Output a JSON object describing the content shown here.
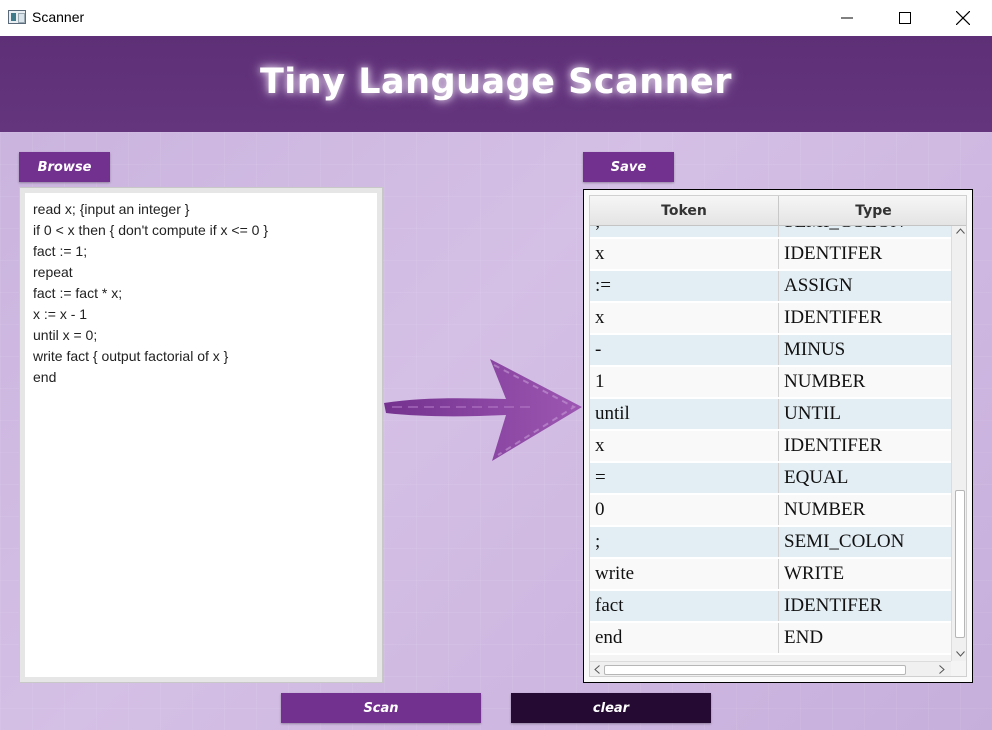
{
  "window": {
    "title": "Scanner",
    "controls": {
      "minimize": "minimize-icon",
      "maximize": "maximize-icon",
      "close": "close-icon"
    }
  },
  "header": {
    "title": "Tiny Language Scanner"
  },
  "buttons": {
    "browse": "Browse",
    "save": "Save",
    "scan": "Scan",
    "clear": "clear"
  },
  "editor": {
    "content": "read x; {input an integer }\nif 0 < x then { don't compute if x <= 0 }\nfact := 1;\nrepeat\nfact := fact * x;\nx := x - 1\nuntil x = 0;\nwrite fact { output factorial of x }\nend"
  },
  "table": {
    "columns": [
      "Token",
      "Type"
    ],
    "rows": [
      {
        "token": ";",
        "type": "SEMI_COLON"
      },
      {
        "token": "x",
        "type": "IDENTIFER"
      },
      {
        "token": ":=",
        "type": "ASSIGN"
      },
      {
        "token": "x",
        "type": "IDENTIFER"
      },
      {
        "token": "-",
        "type": "MINUS"
      },
      {
        "token": "1",
        "type": "NUMBER"
      },
      {
        "token": "until",
        "type": "UNTIL"
      },
      {
        "token": "x",
        "type": "IDENTIFER"
      },
      {
        "token": "=",
        "type": "EQUAL"
      },
      {
        "token": "0",
        "type": "NUMBER"
      },
      {
        "token": ";",
        "type": "SEMI_COLON"
      },
      {
        "token": "write",
        "type": "WRITE"
      },
      {
        "token": "fact",
        "type": "IDENTIFER"
      },
      {
        "token": "end",
        "type": "END"
      }
    ]
  },
  "colors": {
    "header_band": "#5e2f76",
    "button_purple": "#73318f",
    "button_dark": "#250a33",
    "background": "#cdb8e0",
    "row_alt": "#e3eef4"
  },
  "decor": {
    "arrow": "right-arrow-icon"
  }
}
